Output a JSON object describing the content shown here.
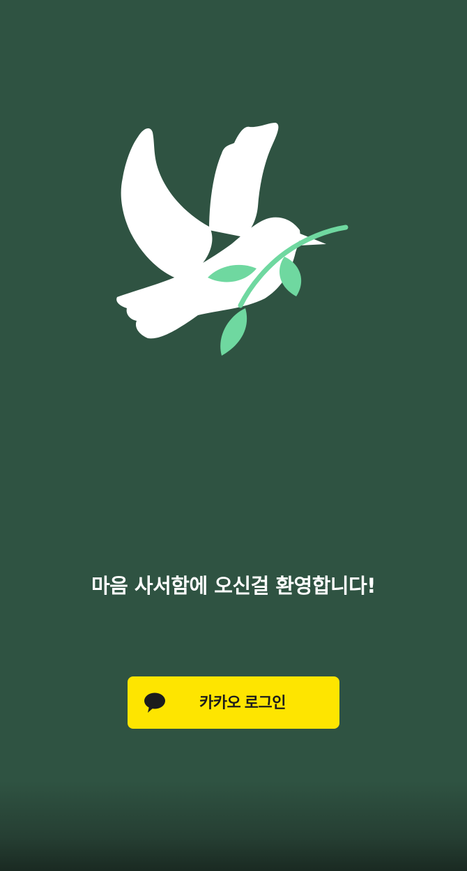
{
  "app": {
    "background_color": "#2f5342"
  },
  "logo": {
    "icon": "dove-with-olive-branch-icon",
    "dove_color": "#ffffff",
    "leaf_color": "#6fd8a0"
  },
  "welcome": {
    "text": "마음 사서함에 오신걸 환영합니다!"
  },
  "login": {
    "label": "카카오 로그인",
    "icon": "kakao-speech-bubble-icon",
    "button_color": "#fee500",
    "text_color": "#1c1c1c"
  }
}
